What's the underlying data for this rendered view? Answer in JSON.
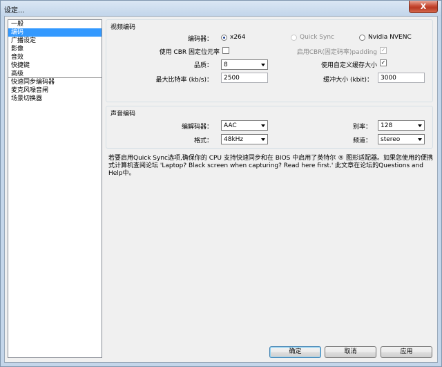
{
  "window": {
    "title": "设定...",
    "close_label": "X"
  },
  "sidebar": {
    "items": [
      {
        "label": "一般"
      },
      {
        "label": "编码"
      },
      {
        "label": "广播设定"
      },
      {
        "label": "影像"
      },
      {
        "label": "音效"
      },
      {
        "label": "快捷键"
      },
      {
        "label": "高级"
      },
      {
        "label": "快速同步编码器"
      },
      {
        "label": "麦克风噪音闸"
      },
      {
        "label": "场景切换器"
      }
    ],
    "selected": "编码"
  },
  "video": {
    "group_label": "视频编码",
    "encoder_label": "编码器：",
    "encoder_options": [
      "x264",
      "Quick Sync",
      "Nvidia NVENC"
    ],
    "encoder_selected": "x264",
    "cbr_label": "使用 CBR 固定位元率",
    "cbr_padding_label": "启用CBR(固定码率)padding",
    "quality_label": "品质：",
    "quality_value": "8",
    "custom_buffer_label": "使用自定义缓存大小",
    "max_bitrate_label": "最大比特率 (kb/s)：",
    "max_bitrate_value": "2500",
    "buffer_size_label": "缓冲大小 (kbit)：",
    "buffer_size_value": "3000"
  },
  "audio": {
    "group_label": "声音编码",
    "codec_label": "编解码器：",
    "codec_value": "AAC",
    "bitrate_label": "别率：",
    "bitrate_value": "128",
    "format_label": "格式：",
    "format_value": "48kHz",
    "channel_label": "频道：",
    "channel_value": "stereo"
  },
  "note": "若要启用Quick Sync选项,确保你的 CPU 支持快速同步和在 BIOS 中启用了英特尔 ® 图形适配器。如果您使用的便携式计算机查阅论坛 'Laptop? Black screen when capturing? Read here first.' 此文章在论坛的Questions and Help中。",
  "buttons": {
    "ok": "确定",
    "cancel": "取消",
    "apply": "应用"
  }
}
